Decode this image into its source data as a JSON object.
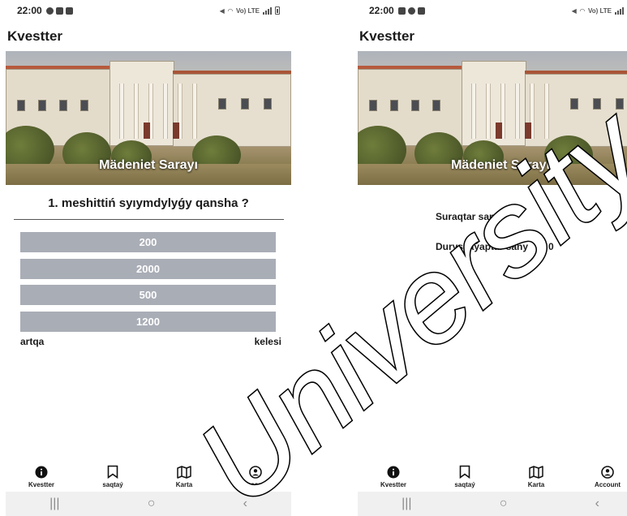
{
  "screens": [
    {
      "status": {
        "time": "22:00",
        "network": "Vo) LTE"
      },
      "app_title": "Kvestter",
      "hero_caption": "Mädeniet Sarayı",
      "quiz": {
        "question": "1. meshittiń syıymdylyǵy qansha ?",
        "answers": [
          "200",
          "2000",
          "500",
          "1200"
        ],
        "back_label": "artqa",
        "next_label": "kelesi"
      },
      "bottom_nav": [
        {
          "label": "Kvestter",
          "icon": "info-icon"
        },
        {
          "label": "saqtaý",
          "icon": "bookmark-icon"
        },
        {
          "label": "Karta",
          "icon": "map-icon"
        },
        {
          "label": "Account",
          "icon": "account-icon"
        }
      ]
    },
    {
      "status": {
        "time": "22:00",
        "network": "Vo) LTE"
      },
      "app_title": "Kvestter",
      "hero_caption": "Mädeniet Sarayı",
      "results": {
        "questions_label": "Suraqtar sany",
        "questions_value": "2",
        "correct_label": "Durys jaýaptar sany",
        "correct_value": "0"
      },
      "bottom_nav": [
        {
          "label": "Kvestter",
          "icon": "info-icon"
        },
        {
          "label": "saqtaý",
          "icon": "bookmark-icon"
        },
        {
          "label": "Karta",
          "icon": "map-icon"
        },
        {
          "label": "Account",
          "icon": "account-icon"
        }
      ]
    }
  ],
  "watermark": "University",
  "colors": {
    "answer_button": "#a9adb6",
    "system_nav": "#f0f0f0"
  }
}
